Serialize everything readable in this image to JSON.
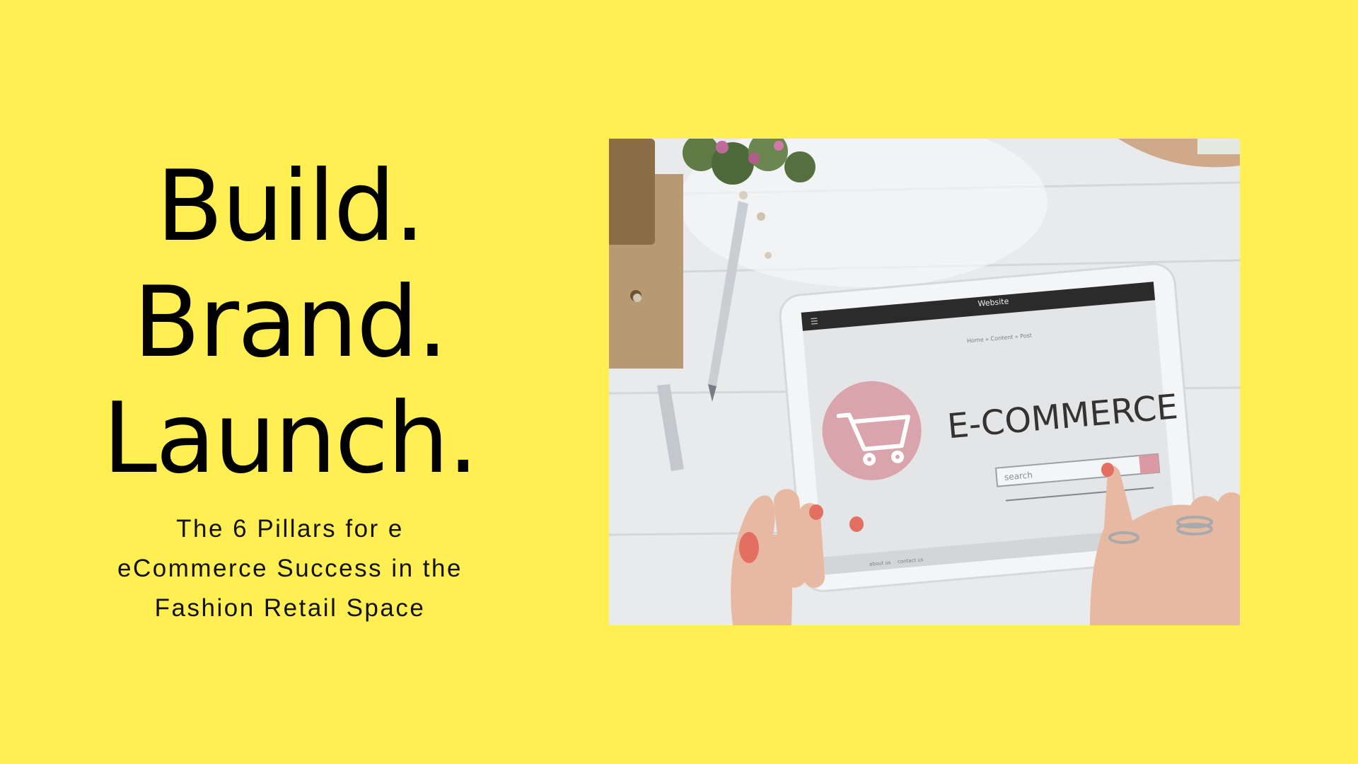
{
  "headline": {
    "line1": "Build.",
    "line2": "Brand.",
    "line3": "Launch."
  },
  "subtitle": {
    "line1": "The 6 Pillars for e",
    "line2": "eCommerce Success in the",
    "line3": "Fashion Retail Space"
  },
  "photo": {
    "tablet_header": "Website",
    "breadcrumb": "Home » Content » Post",
    "brand_text": "E-COMMERCE",
    "search_placeholder": "search",
    "footer_left": "about us",
    "footer_right": "contact us"
  },
  "colors": {
    "background": "#FFEF52",
    "text": "#000000",
    "cart_circle": "#D9A4AC"
  }
}
